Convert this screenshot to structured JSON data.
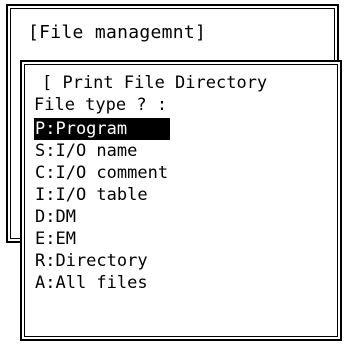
{
  "outer_window": {
    "title": "[File managemnt]"
  },
  "dialog": {
    "title": "[ Print File Directory",
    "prompt": "File type ? :",
    "selected_index": 0,
    "options": [
      {
        "label": "P:Program"
      },
      {
        "label": "S:I/O name"
      },
      {
        "label": "C:I/O comment"
      },
      {
        "label": "I:I/O table"
      },
      {
        "label": "D:DM"
      },
      {
        "label": "E:EM"
      },
      {
        "label": "R:Directory"
      },
      {
        "label": "A:All files"
      }
    ]
  },
  "colors": {
    "background": "#ffffff",
    "foreground": "#000000",
    "highlight_bg": "#000000",
    "highlight_fg": "#ffffff"
  }
}
